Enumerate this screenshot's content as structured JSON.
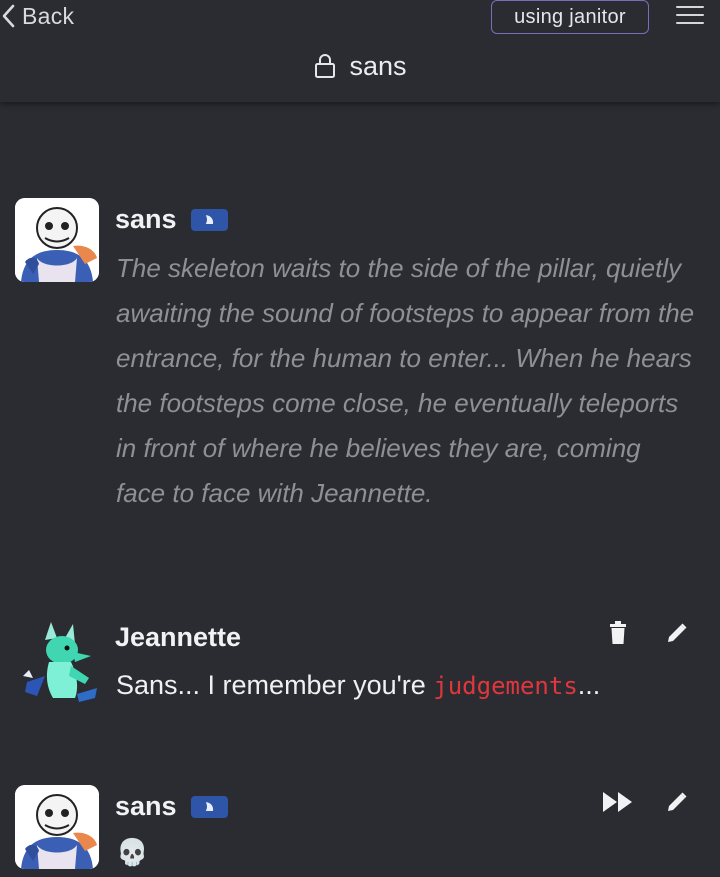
{
  "header": {
    "back_label": "Back",
    "mode_badge": "using janitor",
    "chat_title": "sans"
  },
  "messages": [
    {
      "author": "sans",
      "is_bot": true,
      "text": "The skeleton waits to the side of the pillar, quietly awaiting the sound of footsteps to appear from the entrance, for the human to enter... When he hears the footsteps come close, he eventually teleports in front of where he believes they are, coming face to face with Jeannette."
    },
    {
      "author": "Jeannette",
      "is_bot": false,
      "text_before": "Sans... I remember you're ",
      "text_code": "judgements",
      "text_after": "..."
    },
    {
      "author": "sans",
      "is_bot": true,
      "text": "💀"
    }
  ],
  "colors": {
    "background": "#2b2c31",
    "badge_border": "#7a6dbb",
    "bot_badge": "#2e55a8",
    "code_text": "#e0363d",
    "narration_text": "#8f8f95"
  },
  "icons": [
    "back-chevron-icon",
    "menu-icon",
    "lock-icon",
    "bot-badge-icon",
    "trash-icon",
    "edit-icon",
    "fast-forward-icon",
    "skull-emoji"
  ]
}
